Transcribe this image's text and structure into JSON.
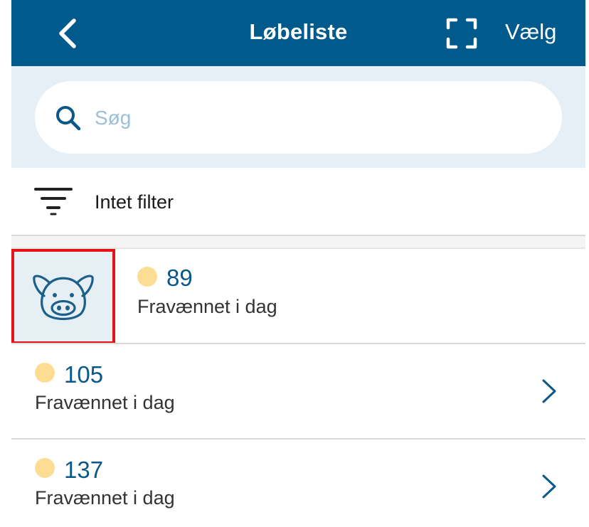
{
  "header": {
    "title": "Løbeliste",
    "select_label": "Vælg",
    "back_icon": "chevron-left-icon",
    "scan_icon": "scan-frame-icon"
  },
  "search": {
    "placeholder": "Søg",
    "value": "",
    "icon": "search-icon"
  },
  "filter": {
    "label": "Intet filter",
    "icon": "filter-icon"
  },
  "colors": {
    "header_bg": "#005a8c",
    "search_band_bg": "#e5eff5",
    "status_dot": "#fddc94",
    "number_text": "#0b5788",
    "highlight_border": "#e8121a"
  },
  "list": {
    "items": [
      {
        "number": "89",
        "status": "Fravænnet i dag",
        "avatar_icon": "pig-icon"
      },
      {
        "number": "105",
        "status": "Fravænnet i dag",
        "chevron_icon": "chevron-right-icon"
      },
      {
        "number": "137",
        "status": "Fravænnet i dag",
        "chevron_icon": "chevron-right-icon"
      }
    ]
  }
}
